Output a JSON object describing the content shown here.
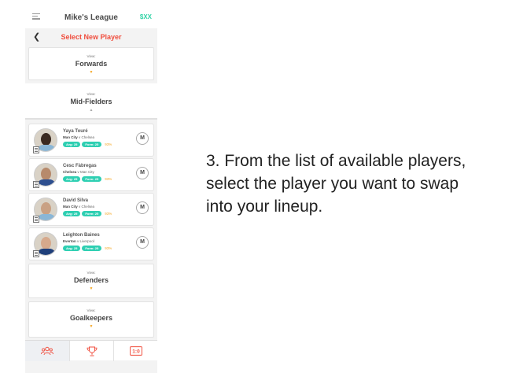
{
  "header": {
    "league_title": "Mike's League",
    "money": "$XX"
  },
  "subheader": {
    "title": "Select New Player"
  },
  "views": {
    "forwards": {
      "small": "View:",
      "title": "Forwards"
    },
    "midfielders": {
      "small": "View:",
      "title": "Mid-Fielders"
    },
    "defenders": {
      "small": "View:",
      "title": "Defenders"
    },
    "goalkeepers": {
      "small": "View:",
      "title": "Goalkeepers"
    }
  },
  "players": [
    {
      "name": "Yaya Touré",
      "team": "Man City",
      "vs": "v Chelsea",
      "avg": "Avg: 25",
      "form": "Form: 25",
      "pct": "93%",
      "position": "M"
    },
    {
      "name": "Cesc Fàbregas",
      "team": "Chelsea",
      "vs": "v Man City",
      "avg": "Avg: 25",
      "form": "Form: 25",
      "pct": "93%",
      "position": "M"
    },
    {
      "name": "David Silva",
      "team": "Man City",
      "vs": "v Chelsea",
      "avg": "Avg: 25",
      "form": "Form: 25",
      "pct": "93%",
      "position": "M"
    },
    {
      "name": "Leighton Baines",
      "team": "Everton",
      "vs": "v Liverpool",
      "avg": "Avg: 25",
      "form": "Form: 25",
      "pct": "93%",
      "position": "M"
    }
  ],
  "tabs": [
    {
      "icon": "team-icon"
    },
    {
      "icon": "trophy-icon"
    },
    {
      "icon": "score-icon",
      "label": "1:0"
    }
  ],
  "instruction": "3. From the list of available players, select the player you want to swap into your lineup.",
  "colors": {
    "accent_red": "#f04e3e",
    "accent_teal": "#2ecfb2",
    "money_green": "#34d3a7",
    "arrow_orange": "#f5a623"
  }
}
